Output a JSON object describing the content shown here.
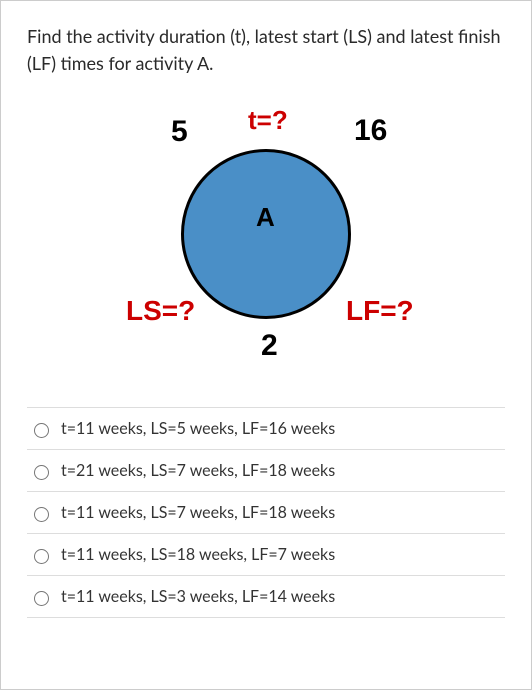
{
  "question": "Find the activity duration (t), latest start (LS) and latest finish (LF)  times for activity A.",
  "diagram": {
    "node_label": "A",
    "top_label": "t=?",
    "top_left": "5",
    "top_right": "16",
    "bottom_left": "LS=?",
    "bottom_right": "LF=?",
    "bottom_center": "2"
  },
  "options": [
    "t=11 weeks, LS=5 weeks, LF=16 weeks",
    "t=21 weeks, LS=7 weeks, LF=18 weeks",
    "t=11 weeks, LS=7 weeks, LF=18 weeks",
    "t=11 weeks, LS=18 weeks, LF=7 weeks",
    "t=11 weeks, LS=3 weeks, LF=14 weeks"
  ]
}
